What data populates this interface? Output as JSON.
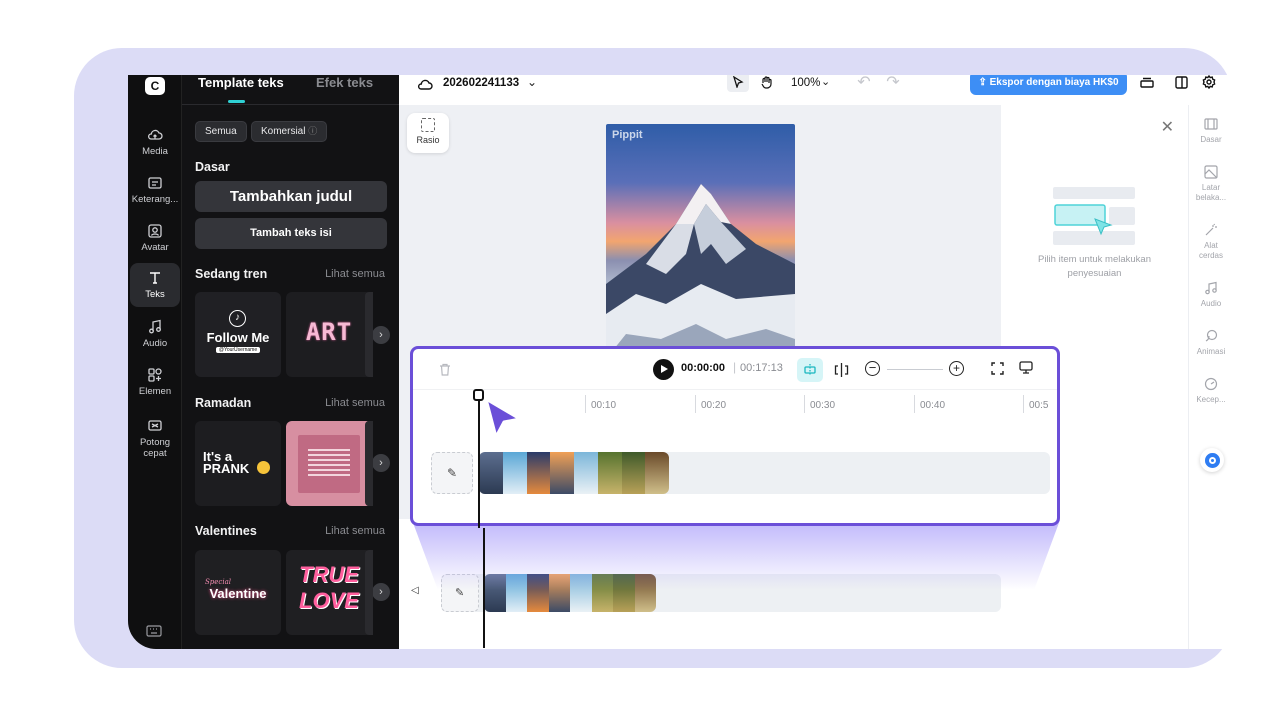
{
  "rail": {
    "items": [
      {
        "label": "Media",
        "icon": "cloud-upload-icon"
      },
      {
        "label": "Keterang...",
        "icon": "caption-icon"
      },
      {
        "label": "Avatar",
        "icon": "avatar-icon"
      },
      {
        "label": "Teks",
        "icon": "text-icon",
        "active": true
      },
      {
        "label": "Audio",
        "icon": "music-icon"
      },
      {
        "label": "Elemen",
        "icon": "elements-icon"
      },
      {
        "label": "Potong cepat",
        "icon": "quick-cut-icon"
      }
    ]
  },
  "panel": {
    "tabs": [
      "Template teks",
      "Efek teks"
    ],
    "chips": [
      "Semua",
      "Komersial"
    ],
    "basic_title": "Dasar",
    "add_title_button": "Tambahkan judul",
    "add_body_button": "Tambah teks isi",
    "sections": [
      {
        "title": "Sedang tren",
        "more": "Lihat semua",
        "cards": [
          "Follow Me",
          "ART"
        ],
        "card_sub": "@YourUsername"
      },
      {
        "title": "Ramadan",
        "more": "Lihat semua",
        "cards": [
          "It's a PRANK",
          "quote"
        ]
      },
      {
        "title": "Valentines",
        "more": "Lihat semua",
        "cards": [
          "Valentine",
          "TRUE LOVE"
        ],
        "card_sub": "Special"
      }
    ]
  },
  "topbar": {
    "project_name": "202602241133",
    "zoom": "100%",
    "export_button": "Ekspor dengan biaya HK$0"
  },
  "canvas": {
    "ratio_label": "Rasio",
    "watermark": "Pippit"
  },
  "right_panel": {
    "hint": "Pilih item untuk melakukan penyesuaian"
  },
  "right_rail": {
    "items": [
      {
        "label": "Dasar"
      },
      {
        "label": "Latar belaka..."
      },
      {
        "label": "Alat cerdas"
      },
      {
        "label": "Audio"
      },
      {
        "label": "Animasi"
      },
      {
        "label": "Kecep..."
      }
    ]
  },
  "timeline": {
    "current_time": "00:00:00",
    "total_time": "00:17:13",
    "ticks": [
      "00:10",
      "00:20",
      "00:30",
      "00:40",
      "00:5"
    ]
  },
  "colors": {
    "accent": "#6b4fd8",
    "export": "#3d8ef5",
    "tab_underline": "#2fd0d4"
  }
}
